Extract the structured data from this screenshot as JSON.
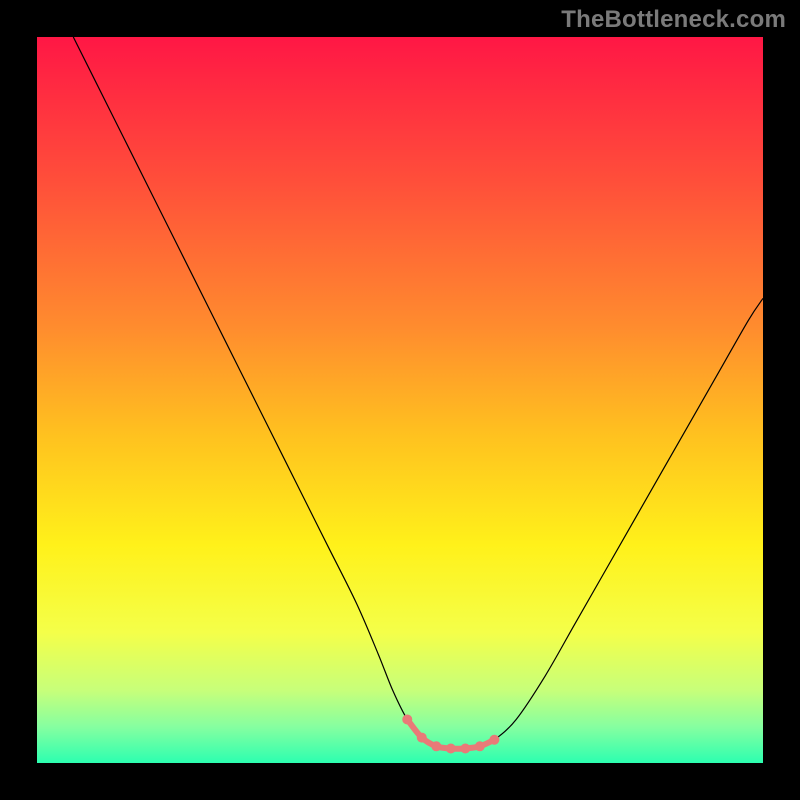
{
  "watermark": "TheBottleneck.com",
  "chart_data": {
    "type": "line",
    "title": "",
    "xlabel": "",
    "ylabel": "",
    "xlim": [
      0,
      100
    ],
    "ylim": [
      0,
      100
    ],
    "grid": false,
    "legend": false,
    "background_gradient": {
      "stops": [
        {
          "pos": 0.0,
          "color": "#ff1745"
        },
        {
          "pos": 0.2,
          "color": "#ff4f3a"
        },
        {
          "pos": 0.4,
          "color": "#ff8c2e"
        },
        {
          "pos": 0.55,
          "color": "#ffc21f"
        },
        {
          "pos": 0.7,
          "color": "#fff11a"
        },
        {
          "pos": 0.82,
          "color": "#f4ff49"
        },
        {
          "pos": 0.9,
          "color": "#c7ff7a"
        },
        {
          "pos": 0.95,
          "color": "#86ffa0"
        },
        {
          "pos": 1.0,
          "color": "#2cffb0"
        }
      ]
    },
    "series": [
      {
        "name": "bottleneck-curve",
        "color": "#000000",
        "width": 1.2,
        "x": [
          5.0,
          8.0,
          12.0,
          16.0,
          20.0,
          24.0,
          28.0,
          32.0,
          36.0,
          40.0,
          44.0,
          47.0,
          49.0,
          51.0,
          53.0,
          55.0,
          57.0,
          59.0,
          61.0,
          63.0,
          66.0,
          70.0,
          74.0,
          78.0,
          82.0,
          86.0,
          90.0,
          94.0,
          98.0,
          100.0
        ],
        "y": [
          100.0,
          94.0,
          86.0,
          78.0,
          70.0,
          62.0,
          54.0,
          46.0,
          38.0,
          30.0,
          22.0,
          15.0,
          10.0,
          6.0,
          3.5,
          2.3,
          2.0,
          2.0,
          2.3,
          3.2,
          6.0,
          12.0,
          19.0,
          26.0,
          33.0,
          40.0,
          47.0,
          54.0,
          61.0,
          64.0
        ]
      },
      {
        "name": "highlight-segment",
        "color": "#e97a78",
        "width": 6,
        "markers": true,
        "marker_radius": 5,
        "x": [
          51.0,
          53.0,
          55.0,
          57.0,
          59.0,
          61.0,
          63.0
        ],
        "y": [
          6.0,
          3.5,
          2.3,
          2.0,
          2.0,
          2.3,
          3.2
        ]
      }
    ]
  }
}
